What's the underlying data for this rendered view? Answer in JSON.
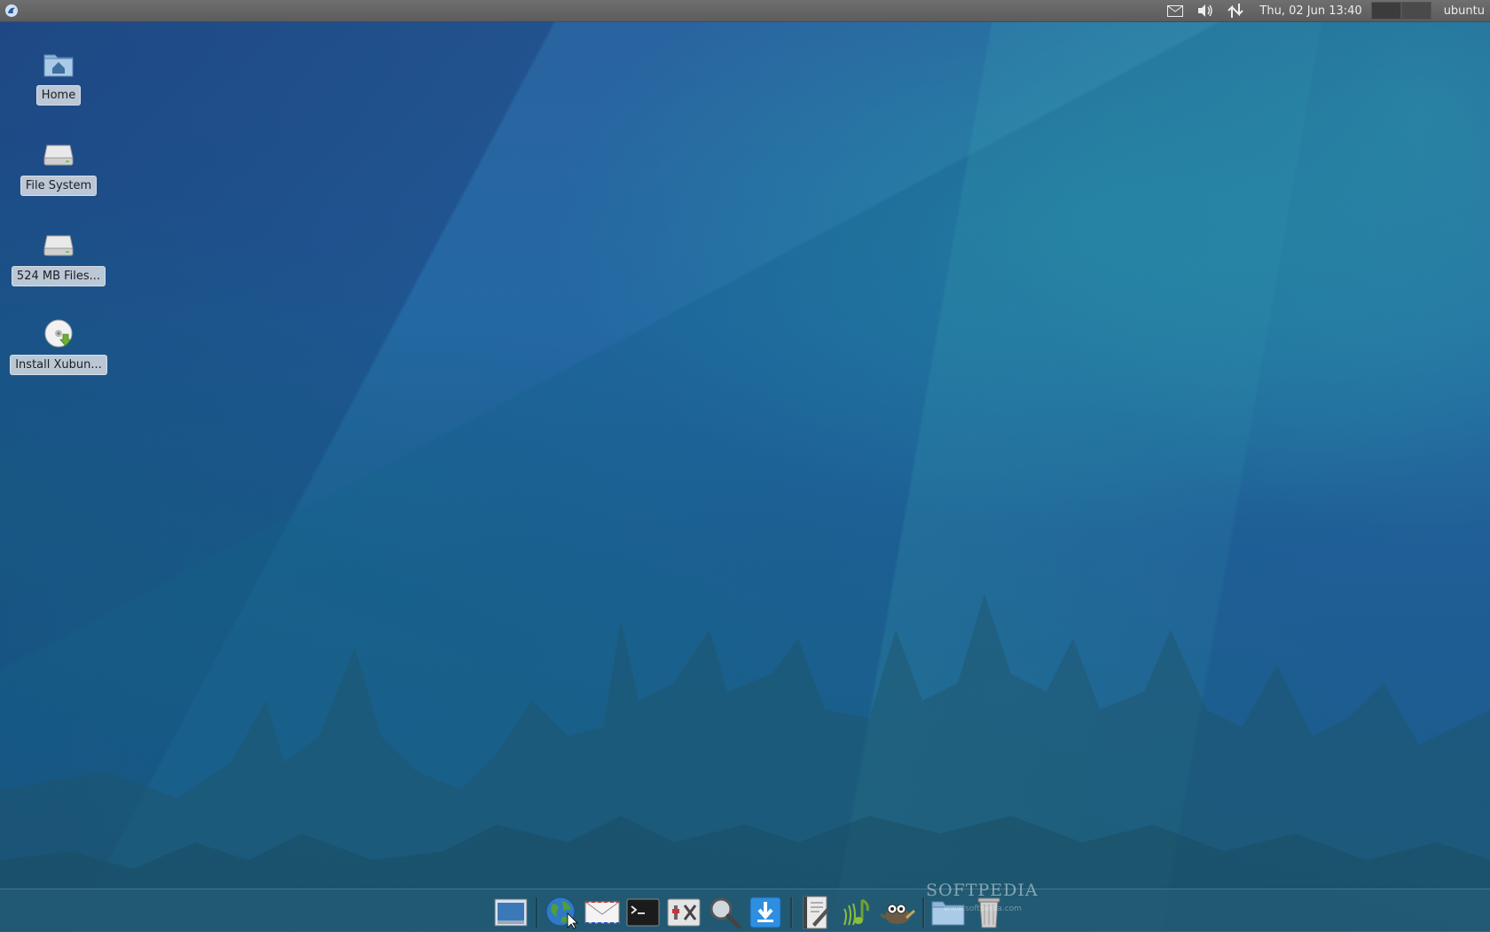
{
  "top_panel": {
    "menu_icon": "xubuntu-menu-icon",
    "tray_icons": [
      "mail-icon",
      "volume-icon",
      "network-icon"
    ],
    "clock": "Thu, 02 Jun  13:40",
    "workspaces": 2,
    "user": "ubuntu"
  },
  "desktop": {
    "icons": [
      {
        "label": "Home",
        "icon": "home-folder-icon"
      },
      {
        "label": "File System",
        "icon": "drive-icon"
      },
      {
        "label": "524 MB Files...",
        "icon": "drive-icon"
      },
      {
        "label": "Install Xubun...",
        "icon": "install-disc-icon"
      }
    ]
  },
  "dock": {
    "items": [
      {
        "name": "show-desktop",
        "icon": "show-desktop-icon"
      },
      {
        "name": "web-browser",
        "icon": "globe-icon"
      },
      {
        "name": "mail",
        "icon": "envelope-icon"
      },
      {
        "name": "terminal",
        "icon": "terminal-icon"
      },
      {
        "name": "settings",
        "icon": "settings-icon"
      },
      {
        "name": "search",
        "icon": "magnifier-icon"
      },
      {
        "name": "downloads",
        "icon": "download-icon"
      },
      {
        "name": "text-editor",
        "icon": "text-editor-icon"
      },
      {
        "name": "media-player",
        "icon": "music-icon"
      },
      {
        "name": "gimp",
        "icon": "gimp-icon"
      },
      {
        "name": "file-manager",
        "icon": "folder-icon"
      },
      {
        "name": "trash",
        "icon": "trash-icon"
      }
    ]
  },
  "watermark": {
    "text": "SOFTPEDIA",
    "url": "www.softpedia.com"
  }
}
